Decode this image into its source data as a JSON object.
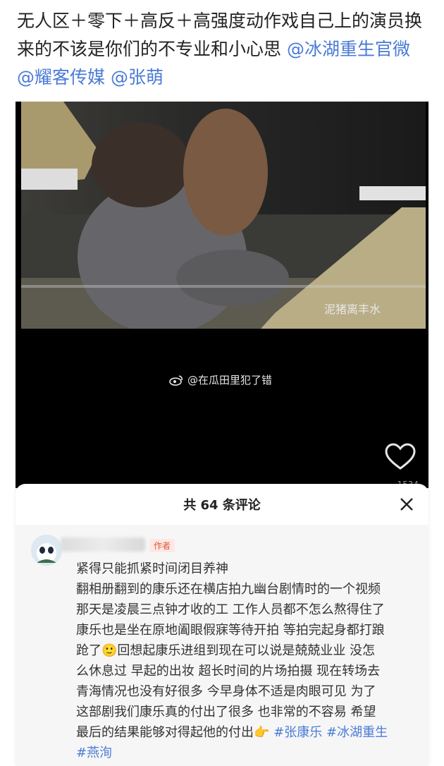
{
  "post": {
    "line1": "无人区＋零下＋高反＋高强度动作戏自己上的演员换",
    "line2": "来的不该是你们的不专业和小心思 ",
    "mention1": "@冰湖重生官微",
    "mention2": "@耀客传媒",
    "mention3": "@张萌"
  },
  "video": {
    "frame_watermark": "泥猪离丰水",
    "watermark": "@在瓜田里犯了错",
    "view_count": "1534"
  },
  "comments_sheet": {
    "title": "共 64 条评论",
    "comment": {
      "username_suffix": "K",
      "author_tag": "作者",
      "lines": [
        "紧得只能抓紧时间闭目养神",
        "翻相册翻到的康乐还在横店拍九幽台剧情时的一个视频",
        "那天是凌晨三点钟才收的工 工作人员都不怎么熬得住了",
        "康乐也是坐在原地阖眼假寐等待开拍 等拍完起身都打踉",
        "跄了",
        "回想起康乐进组到现在可以说是兢兢业业 没怎",
        "么休息过 早起的出妆 超长时间的片场拍摄 现在转场去",
        "青海情况也没有好很多 今早身体不适是肉眼可见 为了",
        "这部剧我们康乐真的付出了很多 也非常的不容易 希望",
        "最后的结果能够对得起他的付出"
      ],
      "hashtags": [
        "#张康乐",
        "#冰湖重生",
        "#燕洵"
      ]
    }
  },
  "colors": {
    "link": "#4a7bd6",
    "author_tag": "#e0563b"
  }
}
